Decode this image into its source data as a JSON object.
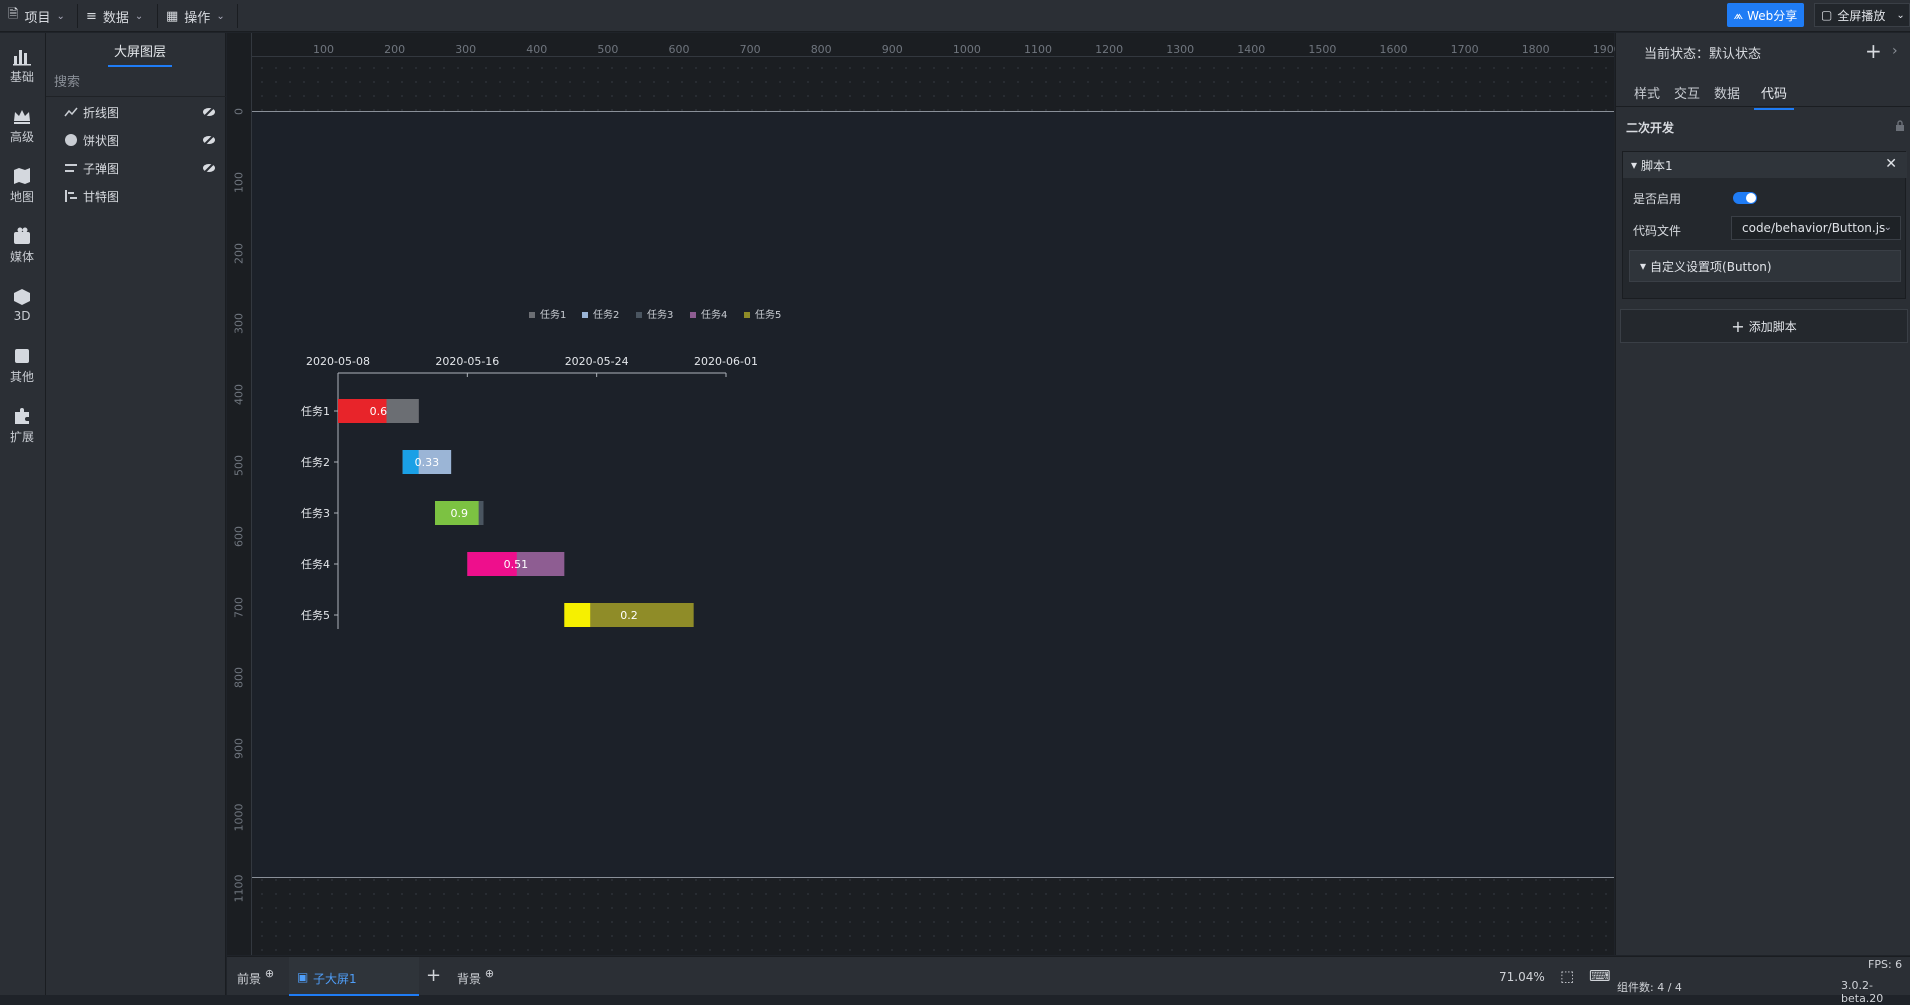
{
  "topbar": {
    "menus": [
      {
        "label": "项目"
      },
      {
        "label": "数据"
      },
      {
        "label": "操作"
      }
    ],
    "share_label": "Web分享",
    "fullscreen_label": "全屏播放"
  },
  "left_icons": [
    {
      "label": "基础",
      "icon": "bar-chart-icon"
    },
    {
      "label": "高级",
      "icon": "crown-icon"
    },
    {
      "label": "地图",
      "icon": "map-icon"
    },
    {
      "label": "媒体",
      "icon": "media-icon"
    },
    {
      "label": "3D",
      "icon": "cube-icon"
    },
    {
      "label": "其他",
      "icon": "list-icon"
    },
    {
      "label": "扩展",
      "icon": "puzzle-icon"
    }
  ],
  "layer_panel": {
    "title": "大屏图层",
    "search_placeholder": "搜索",
    "items": [
      {
        "label": "折线图",
        "icon": "line-chart-icon",
        "hidden": true
      },
      {
        "label": "饼状图",
        "icon": "pie-chart-icon",
        "hidden": true
      },
      {
        "label": "子弹图",
        "icon": "bullet-chart-icon",
        "hidden": true
      },
      {
        "label": "甘特图",
        "icon": "gantt-chart-icon",
        "hidden": false
      }
    ]
  },
  "rulers": {
    "h_ticks": [
      "100",
      "200",
      "300",
      "400",
      "500",
      "600",
      "700",
      "800",
      "900",
      "1000",
      "1100",
      "1200",
      "1300",
      "1400",
      "1500",
      "1600",
      "1700",
      "1800",
      "1900"
    ],
    "v_ticks": [
      "0",
      "100",
      "200",
      "300",
      "400",
      "500",
      "600",
      "700",
      "800",
      "900",
      "1000",
      "1100"
    ]
  },
  "right_panel": {
    "state_label": "当前状态：默认状态",
    "tabs": [
      {
        "label": "样式",
        "active": false
      },
      {
        "label": "交互",
        "active": false
      },
      {
        "label": "数据",
        "active": false
      },
      {
        "label": "代码",
        "active": true
      }
    ],
    "section_title": "二次开发",
    "script": {
      "title": "脚本1",
      "enabled_label": "是否启用",
      "enabled": true,
      "file_label": "代码文件",
      "file_value": "code/behavior/Button.js",
      "custom_label": "自定义设置项(Button)"
    },
    "add_script_label": "添加脚本"
  },
  "bottombar": {
    "foreground_label": "前景",
    "tab_label": "子大屏1",
    "background_label": "背景",
    "zoom": "71.04%",
    "component_count": "组件数: 4 / 4",
    "fps": "FPS: 6",
    "version": "3.0.2-beta.20"
  },
  "chart_data": {
    "type": "bar",
    "subtype": "gantt",
    "x_axis_ticks": [
      "2020-05-08",
      "2020-05-16",
      "2020-05-24",
      "2020-06-01"
    ],
    "x_range": [
      "2020-05-08",
      "2020-06-01"
    ],
    "legend_position": "top",
    "categories": [
      "任务1",
      "任务2",
      "任务3",
      "任务4",
      "任务5"
    ],
    "series": [
      {
        "name": "任务1",
        "start": "2020-05-08",
        "end": "2020-05-13",
        "progress": 0.6,
        "color": "#e8242a",
        "rest_color": "#6b6e73"
      },
      {
        "name": "任务2",
        "start": "2020-05-12",
        "end": "2020-05-15",
        "progress": 0.33,
        "color": "#1aa0e6",
        "rest_color": "#9bb5d6"
      },
      {
        "name": "任务3",
        "start": "2020-05-14",
        "end": "2020-05-17",
        "progress": 0.9,
        "color": "#7cc242",
        "rest_color": "#4a5560"
      },
      {
        "name": "任务4",
        "start": "2020-05-16",
        "end": "2020-05-22",
        "progress": 0.51,
        "color": "#ee0f8c",
        "rest_color": "#8e5d92"
      },
      {
        "name": "任务5",
        "start": "2020-05-22",
        "end": "2020-05-30",
        "progress": 0.2,
        "color": "#f6f000",
        "rest_color": "#8f8c28"
      }
    ]
  }
}
